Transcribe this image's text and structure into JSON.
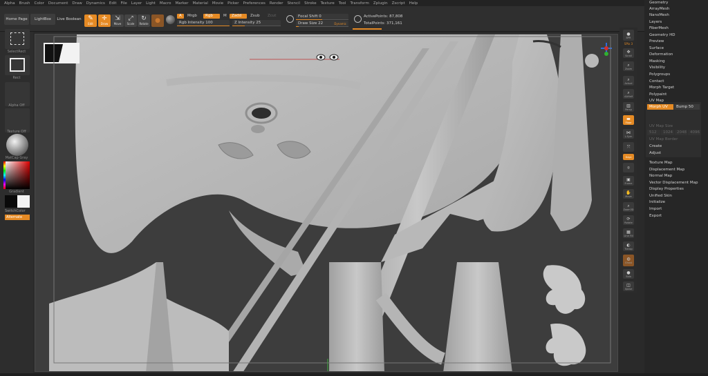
{
  "menu": [
    "Alpha",
    "Brush",
    "Color",
    "Document",
    "Draw",
    "Dynamics",
    "Edit",
    "File",
    "Layer",
    "Light",
    "Macro",
    "Marker",
    "Material",
    "Movie",
    "Picker",
    "Preferences",
    "Render",
    "Stencil",
    "Stroke",
    "Texture",
    "Tool",
    "Transform",
    "Zplugin",
    "Zscript",
    "Help"
  ],
  "toolbar": {
    "home_page": "Home Page",
    "lightbox": "LightBox",
    "live_boolean": "Live Boolean",
    "edit": "Edit",
    "draw": "Draw",
    "move": "Move",
    "scale": "Scale",
    "rotate": "Rotate",
    "a_label": "A",
    "mrgb": "Mrgb",
    "rgb": "Rgb",
    "m": "M",
    "zadd": "Zadd",
    "zsub": "Zsub",
    "zcut": "Zcut",
    "rgb_intensity": "Rgb Intensity 100",
    "z_intensity": "Z Intensity 25",
    "focal_shift": "Focal Shift 0",
    "draw_size": "Draw Size 22",
    "dynamic": "Dynamic",
    "active_points": "ActivePoints: 87,808",
    "total_points": "TotalPoints: 371,161"
  },
  "left_shelf": {
    "select_rect": "SelectRect",
    "rect": "Rect",
    "alpha_off": "Alpha Off",
    "texture_off": "Texture Off",
    "matcap": "MatCap Gray",
    "gradient": "Gradient",
    "switch_color": "SwitchColor",
    "alternate": "Alternate"
  },
  "right_shelf": {
    "bpr": "BPR",
    "spix": "SPix 3",
    "scroll": "Scroll",
    "zoom": "Zoom",
    "actual": "Actual",
    "aahalf": "AAHalf",
    "persp": "Persp",
    "floor": "Floor",
    "local": "L.Sym",
    "gxyz": "Gxyz",
    "frame": "Frame",
    "move": "Move",
    "zoom3d": "Zoom3D",
    "rotate": "Rotate",
    "linefill": "Line Fill",
    "polyf": "PolyF",
    "transp": "Transp",
    "ghost": "Ghost",
    "solo": "Solo",
    "xpose": "Xpose"
  },
  "palette": {
    "items_top": [
      "Geometry",
      "ArrayMesh",
      "NanoMesh",
      "Layers",
      "FiberMesh",
      "Geometry HD",
      "Preview",
      "Surface",
      "Deformation",
      "Masking",
      "Visibility",
      "Polygroups",
      "Contact",
      "Morph Target",
      "Polypaint",
      "UV Map"
    ],
    "uv": {
      "morph_uv": "Morph UV",
      "bump": "Bump 50",
      "uv_map_size": "UV Map Size",
      "sizes": [
        "512",
        "1024",
        "2048",
        "4096"
      ],
      "uv_map_border": "UV Map Border",
      "create": "Create",
      "adjust": "Adjust"
    },
    "items_bottom": [
      "Texture Map",
      "Displacement Map",
      "Normal Map",
      "Vector Displacement Map",
      "Display Properties",
      "Unified Skin",
      "Initialize",
      "Import",
      "Export"
    ]
  },
  "colors": {
    "accent": "#e58a24",
    "canvas": "#3d3d3d",
    "mesh": "#bdbdbd"
  }
}
